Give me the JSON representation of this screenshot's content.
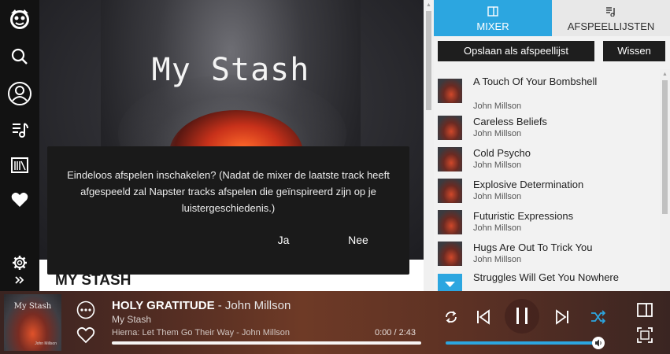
{
  "sidebar": {
    "items": [
      "napster-logo-icon",
      "search-icon",
      "profile-icon",
      "music-library-icon",
      "radio-icon",
      "favorites-icon",
      "settings-icon",
      "expand-icon"
    ]
  },
  "main": {
    "cover_title": "My Stash",
    "page_title": "MY STASH"
  },
  "dialog": {
    "message": "Eindeloos afspelen inschakelen? (Nadat de mixer de laatste track heeft afgespeeld zal Napster tracks afspelen die geïnspireerd zijn op je luistergeschiedenis.)",
    "yes_label": "Ja",
    "no_label": "Nee"
  },
  "panel": {
    "tabs": [
      {
        "label": "MIXER",
        "icon": "mixer-icon"
      },
      {
        "label": "AFSPEELLIJSTEN",
        "icon": "playlist-icon"
      }
    ],
    "save_label": "Opslaan als afspeellijst",
    "clear_label": "Wissen",
    "tracks": [
      {
        "title": "A Touch Of Your Bombshell",
        "artist": "John Millson"
      },
      {
        "title": "Careless Beliefs",
        "artist": "John Millson"
      },
      {
        "title": "Cold Psycho",
        "artist": "John Millson"
      },
      {
        "title": "Explosive Determination",
        "artist": "John Millson"
      },
      {
        "title": "Futuristic Expressions",
        "artist": "John Millson"
      },
      {
        "title": "Hugs Are Out To Trick You",
        "artist": "John Millson"
      },
      {
        "title": "Struggles Will Get You Nowhere",
        "artist": ""
      }
    ]
  },
  "player": {
    "album_art_title": "My Stash",
    "album_art_artist": "John Millson",
    "track_title": "HOLY GRATITUDE",
    "track_artist": " - John Millson",
    "playlist": "My Stash",
    "next_up": "Hierna: Let Them Go Their Way - John Millson",
    "time": "0:00 / 2:43",
    "progress": 0.0,
    "volume": 0.99,
    "accent_color": "#2ca6e0"
  }
}
